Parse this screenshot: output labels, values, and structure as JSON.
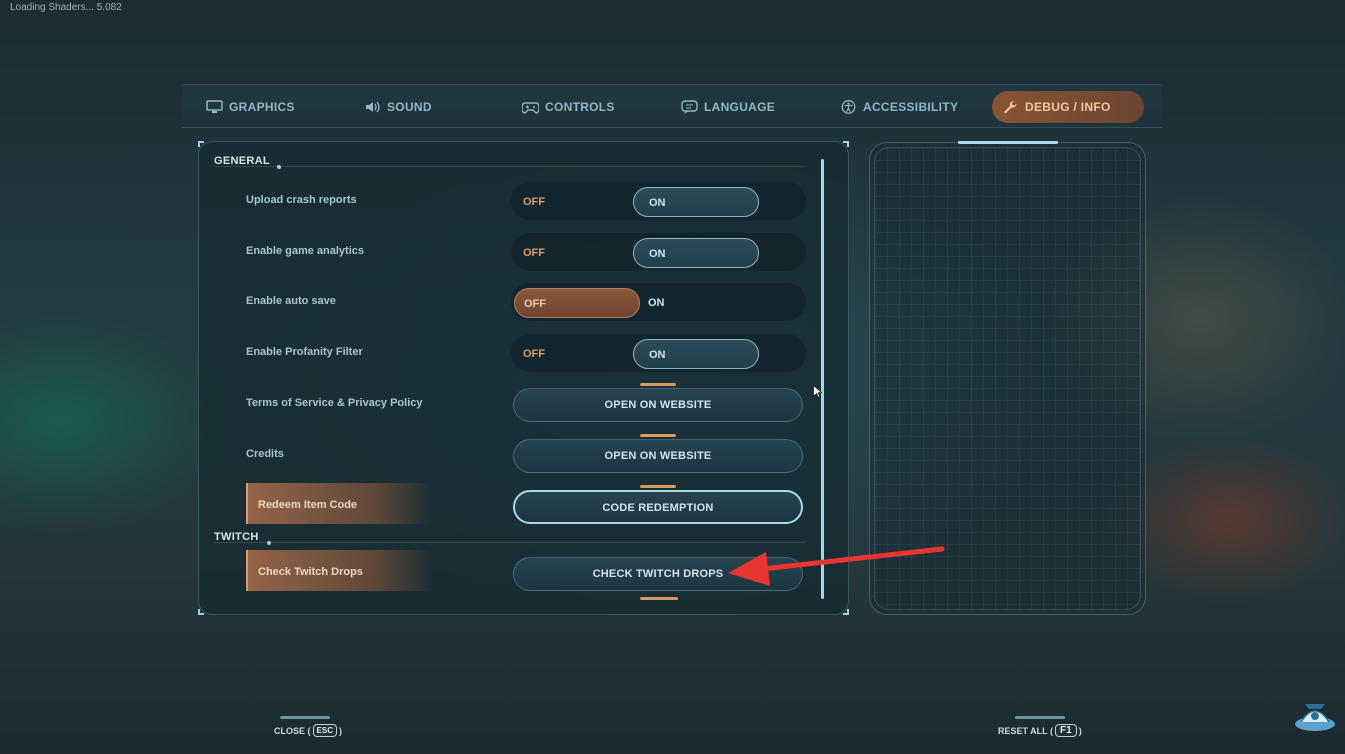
{
  "loading_text": "Loading Shaders... 5.082",
  "tabs": [
    {
      "label": "GRAPHICS",
      "icon": "monitor-icon"
    },
    {
      "label": "SOUND",
      "icon": "speaker-icon"
    },
    {
      "label": "CONTROLS",
      "icon": "gamepad-icon"
    },
    {
      "label": "LANGUAGE",
      "icon": "speech-bubble-icon"
    },
    {
      "label": "ACCESSIBILITY",
      "icon": "accessibility-icon"
    },
    {
      "label": "DEBUG / INFO",
      "icon": "wrench-icon",
      "active": true
    }
  ],
  "sections": {
    "general": "GENERAL",
    "twitch": "TWITCH"
  },
  "settings": [
    {
      "label": "Upload crash reports",
      "type": "toggle",
      "off": "OFF",
      "on": "ON",
      "value": "ON"
    },
    {
      "label": "Enable game analytics",
      "type": "toggle",
      "off": "OFF",
      "on": "ON",
      "value": "ON"
    },
    {
      "label": "Enable auto save",
      "type": "toggle",
      "off": "OFF",
      "on": "ON",
      "value": "OFF"
    },
    {
      "label": "Enable Profanity Filter",
      "type": "toggle",
      "off": "OFF",
      "on": "ON",
      "value": "ON"
    },
    {
      "label": "Terms of Service & Privacy Policy",
      "type": "button",
      "button": "OPEN ON WEBSITE"
    },
    {
      "label": "Credits",
      "type": "button",
      "button": "OPEN ON WEBSITE"
    },
    {
      "label": "Redeem Item Code",
      "type": "button",
      "button": "CODE REDEMPTION"
    }
  ],
  "twitch_settings": [
    {
      "label": "Check Twitch Drops",
      "type": "button",
      "button": "CHECK TWITCH DROPS"
    }
  ],
  "footer": {
    "close_label": "CLOSE (",
    "close_key": "ESC",
    "close_end": ")",
    "reset_label": "RESET ALL (",
    "reset_key": "F1",
    "reset_end": ")"
  },
  "colors": {
    "accent_orange": "#d99a5f",
    "accent_teal": "#a6d6e2",
    "annotation_arrow": "#e8352f"
  }
}
